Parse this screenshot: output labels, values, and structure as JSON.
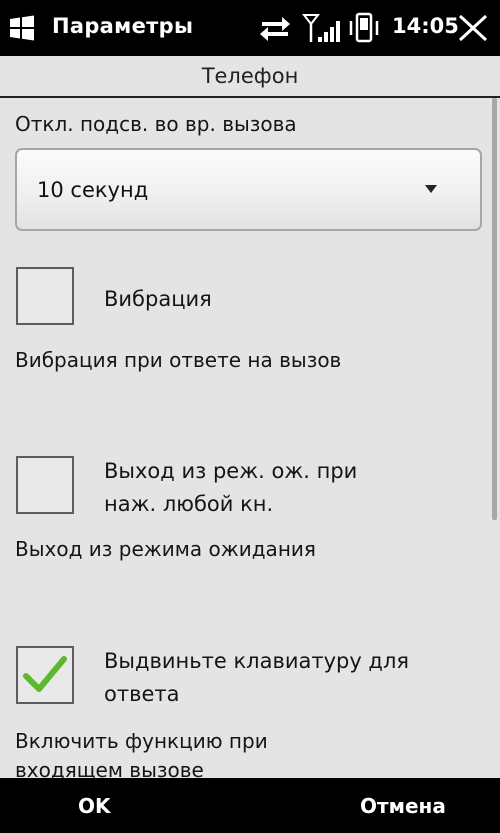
{
  "status_bar": {
    "app_title": "Параметры",
    "time": "14:05",
    "icons": [
      "windows-start-icon",
      "data-transfer-icon",
      "signal-icon",
      "phone-vibrate-icon",
      "close-icon"
    ]
  },
  "section": {
    "title": "Телефон"
  },
  "backlight": {
    "label": "Откл. подсв. во вр. вызова",
    "selected_value": "10 секунд"
  },
  "options": [
    {
      "label": "Вибрация",
      "description": "Вибрация при ответе на вызов",
      "checked": false
    },
    {
      "label_line1": "Выход из реж. ож. при",
      "label_line2": "наж. любой кн.",
      "description": "Выход из режима ожидания",
      "checked": false
    },
    {
      "label_line1": "Выдвиньте клавиатуру для",
      "label_line2": "ответа",
      "description_line1": "Включить функцию при",
      "description_line2": "входящем вызове",
      "checked": true
    }
  ],
  "softkeys": {
    "left": "OK",
    "right": "Отмена"
  },
  "colors": {
    "bar_bg": "#000000",
    "screen_bg": "#e4e4e4",
    "check_green": "#5cb82c"
  }
}
